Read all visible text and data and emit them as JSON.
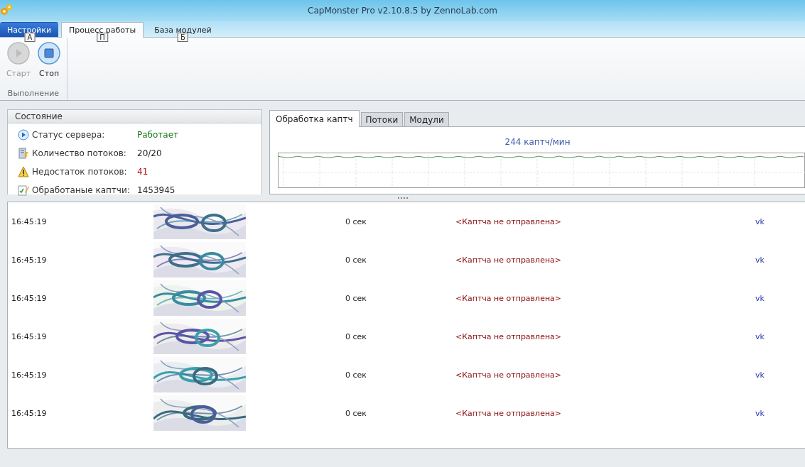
{
  "window": {
    "title": "CapMonster Pro v2.10.8.5 by ZennoLab.com"
  },
  "ribbon_tabs": [
    {
      "label": "Настройки",
      "kind": "app",
      "keytip": "А",
      "selected": false
    },
    {
      "label": "Процесс работы",
      "kind": "tab",
      "keytip": "П",
      "selected": true
    },
    {
      "label": "База модулей",
      "kind": "tab",
      "keytip": "Б",
      "selected": false
    }
  ],
  "ribbon_group": {
    "title": "Выполнение",
    "buttons": [
      {
        "label": "Старт",
        "kind": "start",
        "disabled": true
      },
      {
        "label": "Стоп",
        "kind": "stop",
        "disabled": false
      }
    ]
  },
  "status_panel": {
    "title": "Состояние",
    "rows": [
      {
        "kind": "server",
        "label": "Статус сервера:",
        "value": "Работает",
        "color": "#1a7a1a"
      },
      {
        "kind": "threads",
        "label": "Количество потоков:",
        "value": "20/20",
        "color": "#222222"
      },
      {
        "kind": "warning",
        "label": "Недостаток потоков:",
        "value": "41",
        "color": "#b01010"
      },
      {
        "kind": "done",
        "label": "Обработаные каптчи:",
        "value": "1453945",
        "color": "#222222"
      }
    ]
  },
  "chart_tabs": [
    {
      "label": "Обработка каптч",
      "selected": true
    },
    {
      "label": "Потоки",
      "selected": false
    },
    {
      "label": "Модули",
      "selected": false
    }
  ],
  "chart_rate": "244 каптч/мин",
  "rows": [
    {
      "time": "16:45:19",
      "duration": "0 сек",
      "status": "<Каптча не отправлена>",
      "module": "vk",
      "kind": "picture"
    },
    {
      "time": "16:45:19",
      "duration": "0 сек",
      "status": "<Каптча не отправлена>",
      "module": "vk",
      "kind": "picture"
    },
    {
      "time": "16:45:19",
      "duration": "0 сек",
      "status": "<Каптча не отправлена>",
      "module": "vk",
      "kind": "picture"
    },
    {
      "time": "16:45:19",
      "duration": "0 сек",
      "status": "<Каптча не отправлена>",
      "module": "vk",
      "kind": "picture"
    },
    {
      "time": "16:45:19",
      "duration": "0 сек",
      "status": "<Каптча не отправлена>",
      "module": "vk",
      "kind": "picture"
    },
    {
      "time": "16:45:19",
      "duration": "0 сек",
      "status": "<Каптча не отправлена>",
      "module": "vk",
      "kind": "picture"
    }
  ]
}
